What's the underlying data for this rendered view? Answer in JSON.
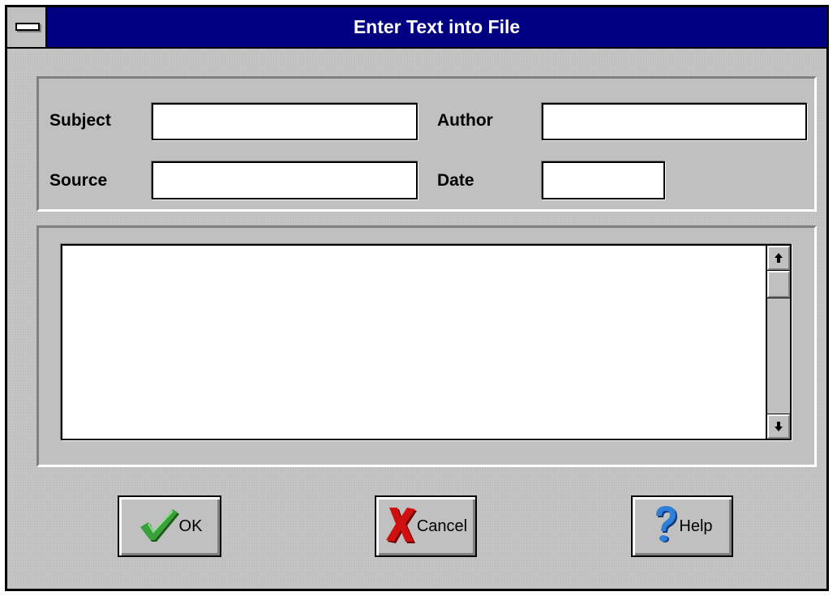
{
  "window": {
    "title": "Enter Text into File"
  },
  "fields": {
    "subject_label": "Subject",
    "subject_value": "",
    "author_label": "Author",
    "author_value": "",
    "source_label": "Source",
    "source_value": "",
    "date_label": "Date",
    "date_value": ""
  },
  "body_text": {
    "value": ""
  },
  "buttons": {
    "ok_label": "OK",
    "cancel_label": "Cancel",
    "help_label": "Help"
  },
  "icons": {
    "system_menu": "system-menu-icon",
    "ok": "checkmark-icon",
    "cancel": "red-x-icon",
    "help": "question-mark-icon",
    "scroll_up": "arrow-up-icon",
    "scroll_down": "arrow-down-icon"
  },
  "colors": {
    "titlebar": "#000080",
    "checkmark": "#2e8b2e",
    "cancel_x": "#d01010",
    "help_question": "#2060c0",
    "face": "#c0c0c0"
  }
}
